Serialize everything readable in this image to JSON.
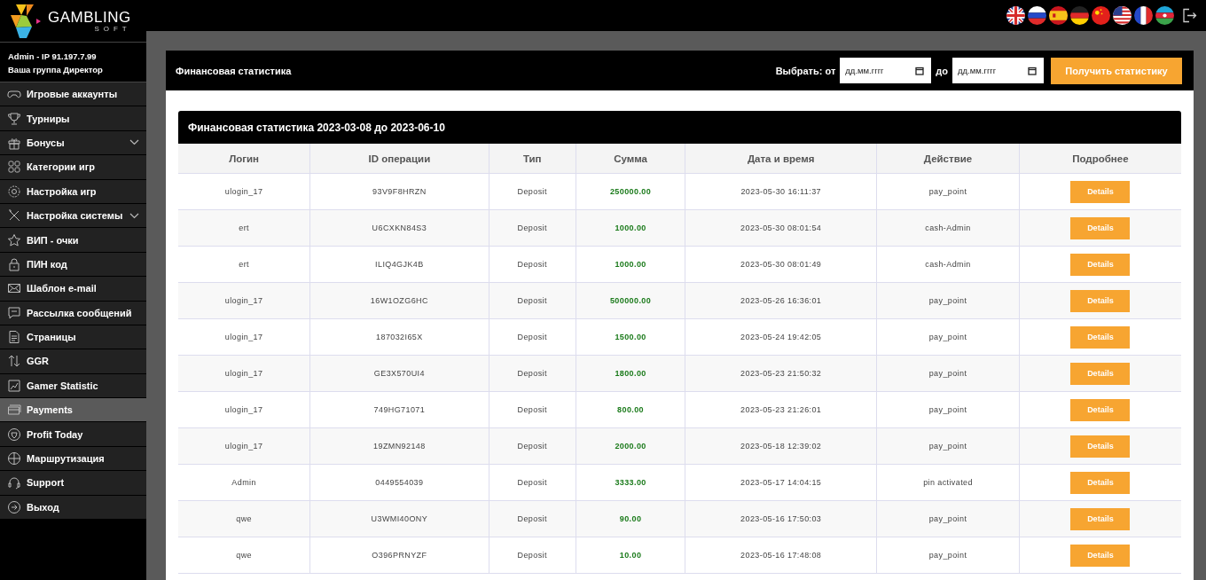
{
  "logo": {
    "title": "GAMBLING",
    "subtitle": "SOFT"
  },
  "user": {
    "line1": "Admin - IP 91.197.7.99",
    "line2": "Ваша группа Директор"
  },
  "sidebar": {
    "items": [
      {
        "label": "Игровые аккаунты",
        "selected": false,
        "expandable": false
      },
      {
        "label": "Турниры",
        "selected": false,
        "expandable": false
      },
      {
        "label": "Бонусы",
        "selected": false,
        "expandable": true
      },
      {
        "label": "Категории игр",
        "selected": false,
        "expandable": false
      },
      {
        "label": "Настройка игр",
        "selected": false,
        "expandable": false
      },
      {
        "label": "Настройка системы",
        "selected": false,
        "expandable": true
      },
      {
        "label": "ВИП - очки",
        "selected": false,
        "expandable": false
      },
      {
        "label": "ПИН код",
        "selected": false,
        "expandable": false
      },
      {
        "label": "Шаблон e-mail",
        "selected": false,
        "expandable": false
      },
      {
        "label": "Рассылка сообщений",
        "selected": false,
        "expandable": false
      },
      {
        "label": "Страницы",
        "selected": false,
        "expandable": false
      },
      {
        "label": "GGR",
        "selected": false,
        "expandable": false
      },
      {
        "label": "Gamer Statistic",
        "selected": false,
        "expandable": false
      },
      {
        "label": "Payments",
        "selected": true,
        "expandable": false
      },
      {
        "label": "Profit Today",
        "selected": false,
        "expandable": false
      },
      {
        "label": "Маршрутизация",
        "selected": false,
        "expandable": false
      },
      {
        "label": "Support",
        "selected": false,
        "expandable": false
      },
      {
        "label": "Выход",
        "selected": false,
        "expandable": false
      }
    ]
  },
  "languages": [
    {
      "kind": "gb"
    },
    {
      "kind": "ru"
    },
    {
      "kind": "es"
    },
    {
      "kind": "de"
    },
    {
      "kind": "cn"
    },
    {
      "kind": "us"
    },
    {
      "kind": "fr"
    },
    {
      "kind": "az"
    }
  ],
  "card": {
    "title": "Финансовая статистика",
    "range_label": "Выбрать: от",
    "from_placeholder": "дд.мм.гггг",
    "to_label": "до",
    "to_placeholder": "дд.мм.гггг",
    "submit": "Получить статистику"
  },
  "table": {
    "title": "Финансовая статистика 2023-03-08 до 2023-06-10",
    "columns": [
      "Логин",
      "ID операции",
      "Тип",
      "Сумма",
      "Дата и время",
      "Действие",
      "Подробнее"
    ],
    "rows": [
      {
        "login": "ulogin_17",
        "id": "93V9F8HRZN",
        "type": "Deposit",
        "amount": "250000.00",
        "datetime": "2023-05-30 16:11:37",
        "action": "pay_point",
        "details": "Details"
      },
      {
        "login": "ert",
        "id": "U6CXKN84S3",
        "type": "Deposit",
        "amount": "1000.00",
        "datetime": "2023-05-30 08:01:54",
        "action": "cash-Admin",
        "details": "Details"
      },
      {
        "login": "ert",
        "id": "ILIQ4GJK4B",
        "type": "Deposit",
        "amount": "1000.00",
        "datetime": "2023-05-30 08:01:49",
        "action": "cash-Admin",
        "details": "Details"
      },
      {
        "login": "ulogin_17",
        "id": "16W1OZG6HC",
        "type": "Deposit",
        "amount": "500000.00",
        "datetime": "2023-05-26 16:36:01",
        "action": "pay_point",
        "details": "Details"
      },
      {
        "login": "ulogin_17",
        "id": "187032I65X",
        "type": "Deposit",
        "amount": "1500.00",
        "datetime": "2023-05-24 19:42:05",
        "action": "pay_point",
        "details": "Details"
      },
      {
        "login": "ulogin_17",
        "id": "GE3X570UI4",
        "type": "Deposit",
        "amount": "1800.00",
        "datetime": "2023-05-23 21:50:32",
        "action": "pay_point",
        "details": "Details"
      },
      {
        "login": "ulogin_17",
        "id": "749HG71071",
        "type": "Deposit",
        "amount": "800.00",
        "datetime": "2023-05-23 21:26:01",
        "action": "pay_point",
        "details": "Details"
      },
      {
        "login": "ulogin_17",
        "id": "19ZMN92148",
        "type": "Deposit",
        "amount": "2000.00",
        "datetime": "2023-05-18 12:39:02",
        "action": "pay_point",
        "details": "Details"
      },
      {
        "login": "Admin",
        "id": "0449554039",
        "type": "Deposit",
        "amount": "3333.00",
        "datetime": "2023-05-17 14:04:15",
        "action": "pin activated",
        "details": "Details"
      },
      {
        "login": "qwe",
        "id": "U3WMI40ONY",
        "type": "Deposit",
        "amount": "90.00",
        "datetime": "2023-05-16 17:50:03",
        "action": "pay_point",
        "details": "Details"
      },
      {
        "login": "qwe",
        "id": "O396PRNYZF",
        "type": "Deposit",
        "amount": "10.00",
        "datetime": "2023-05-16 17:48:08",
        "action": "pay_point",
        "details": "Details"
      }
    ]
  }
}
